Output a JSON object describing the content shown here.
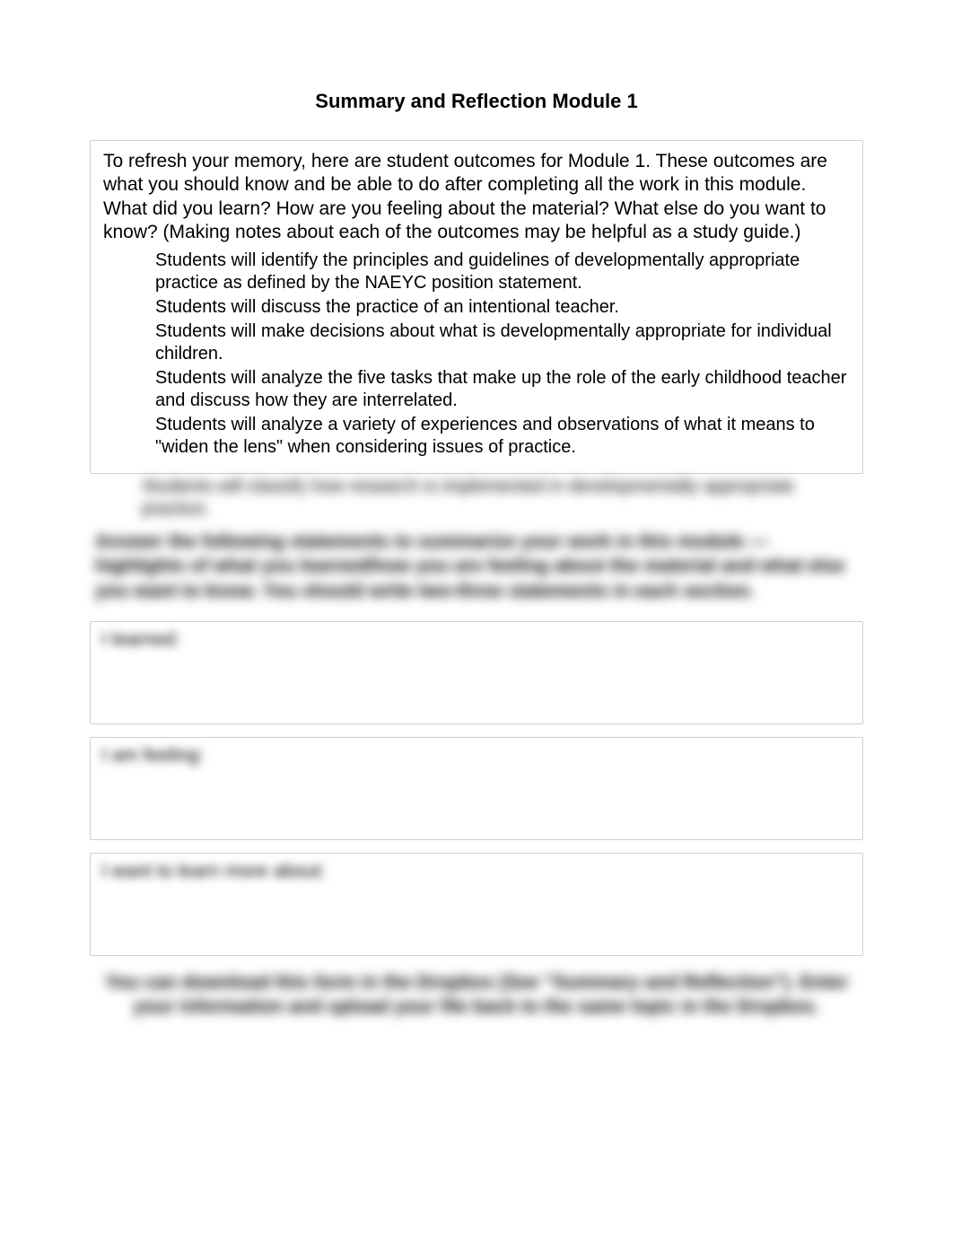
{
  "title": "Summary and Reflection Module 1",
  "intro": "To refresh your memory, here are student outcomes for Module 1. These outcomes are what you should know and be able to do after completing all the work in this module. What did you learn? How are you feeling about the material? What else do you want to know? (Making notes about each of the outcomes may be helpful as a study guide.)",
  "outcomes": [
    "Students will identify the principles and guidelines of developmentally appropriate practice as defined by the NAEYC position statement.",
    "Students will discuss the practice of an intentional teacher.",
    "Students will make decisions about what is developmentally appropriate for individual children.",
    "Students will analyze the five tasks that make up the role of the early childhood teacher and discuss how they are interrelated.",
    "Students will analyze a variety of experiences and observations of what it means to \"widen the lens\" when considering issues of practice."
  ],
  "blurred_outcome": "Students will classify how research is implemented in developmentally appropriate practice.",
  "blurred_instruction": "Answer the following statements to summarize your work in this module — highlights of what you learned/how you are feeling about the material and what else you want to know. You should write two-three statements in each section.",
  "form": {
    "learned_label": "I learned:",
    "feeling_label": "I am feeling:",
    "want_label": "I want to learn more about:"
  },
  "footer": "You can download this form in the Dropbox (See \"Summary and Reflection\"). Enter your information and upload your file back to the same topic in the Dropbox."
}
